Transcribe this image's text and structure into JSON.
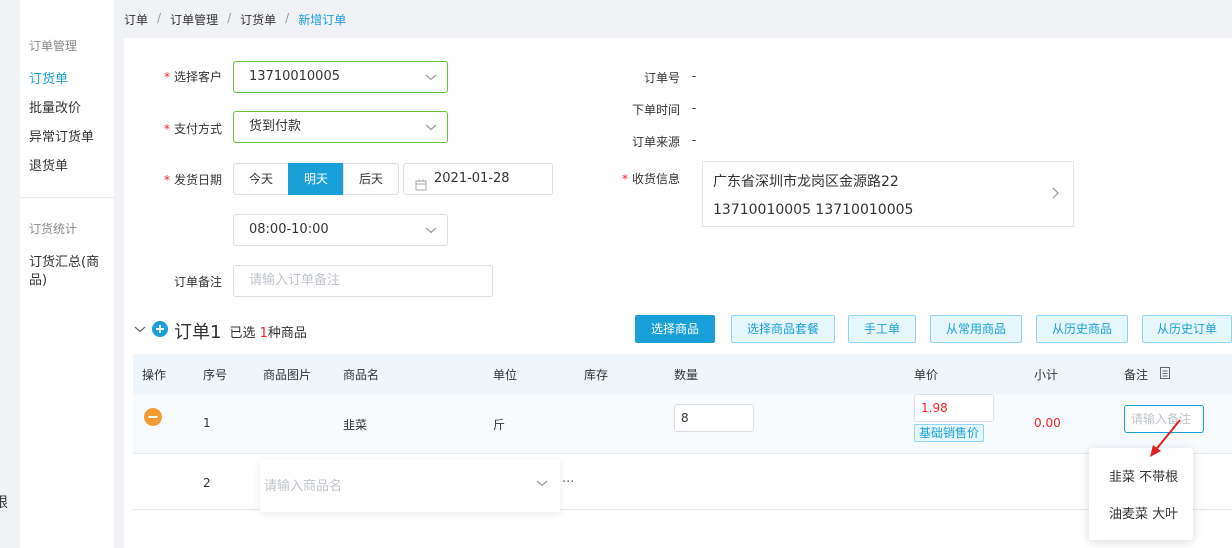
{
  "edge_char": "根",
  "sidebar": {
    "group1": "订单管理",
    "items1": [
      "订货单",
      "批量改价",
      "异常订货单",
      "退货单"
    ],
    "group2": "订货统计",
    "items2": [
      "订货汇总(商品)"
    ]
  },
  "breadcrumb": [
    "订单",
    "订单管理",
    "订货单",
    "新增订单"
  ],
  "form": {
    "customer_label": "选择客户",
    "customer_value": "13710010005",
    "pay_label": "支付方式",
    "pay_value": "货到付款",
    "ship_label": "发货日期",
    "ship_options": [
      "今天",
      "明天",
      "后天"
    ],
    "ship_selected": "明天",
    "date_value": "2021-01-28",
    "time_value": "08:00-10:00",
    "note_label": "订单备注",
    "note_placeholder": "请输入订单备注"
  },
  "info": {
    "order_no_label": "订单号",
    "order_no_value": "-",
    "order_time_label": "下单时间",
    "order_time_value": "-",
    "source_label": "订单来源",
    "source_value": "-",
    "receiver_label": "收货信息",
    "address": "广东省深圳市龙岗区金源路22",
    "contact": "13710010005 13710010005"
  },
  "order": {
    "title": "订单1",
    "selected_prefix": "已选",
    "selected_count": "1",
    "selected_suffix": "种商品",
    "buttons": [
      "选择商品",
      "选择商品套餐",
      "手工单",
      "从常用商品",
      "从历史商品",
      "从历史订单"
    ]
  },
  "table": {
    "headers": [
      "操作",
      "序号",
      "商品图片",
      "商品名",
      "单位",
      "库存",
      "数量",
      "单价",
      "小计",
      "备注"
    ],
    "row1": {
      "index": "1",
      "name": "韭菜",
      "unit": "斤",
      "qty": "8",
      "price": "1.98",
      "price_tag": "基础销售价",
      "subtotal": "0.00",
      "note_placeholder": "请输入备注"
    },
    "row2": {
      "index": "2",
      "name_placeholder": "请输入商品名",
      "more": "···"
    }
  },
  "popup": {
    "options": [
      "韭菜 不带根",
      "油麦菜 大叶"
    ]
  }
}
